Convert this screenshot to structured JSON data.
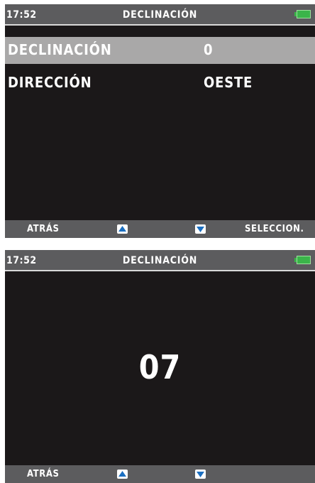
{
  "colors": {
    "screen_bg": "#1b1819",
    "bar_bg": "#5c5c5e",
    "selected_row": "#a9a8a8",
    "battery": "#3bb44a",
    "arrow": "#1b6fc1"
  },
  "screen1": {
    "status": {
      "time": "17:52",
      "title": "DECLINACIÓN"
    },
    "menu": [
      {
        "label": "DECLINACIÓN",
        "value": "0",
        "selected": true
      },
      {
        "label": "DIRECCIÓN",
        "value": "OESTE",
        "selected": false
      }
    ],
    "softkeys": {
      "left": "ATRÁS",
      "up_icon": "arrow-up",
      "down_icon": "arrow-down",
      "right": "SELECCION."
    }
  },
  "screen2": {
    "status": {
      "time": "17:52",
      "title": "DECLINACIÓN"
    },
    "value": "07",
    "softkeys": {
      "left": "ATRÁS",
      "up_icon": "arrow-up",
      "down_icon": "arrow-down"
    }
  }
}
